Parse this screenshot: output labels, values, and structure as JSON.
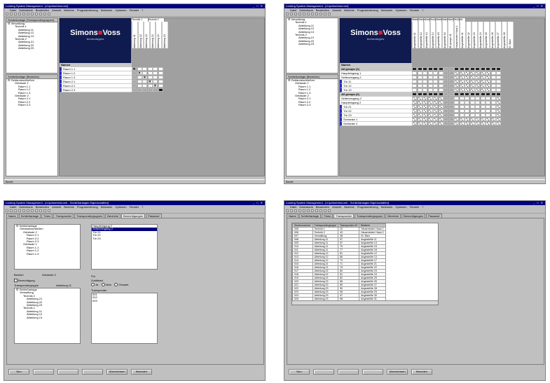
{
  "app": {
    "title": "Locking System Management - [d:\\pc\\lsm\\test.xml]",
    "title_props": "Locking System Management - [d:\\pc\\lsm\\test.xml - Schließanlagen Eigenschaften]",
    "menu": [
      "Datei",
      "Datenbank",
      "Bearbeiten",
      "Ansicht",
      "Berichte",
      "Programmierung",
      "Netzwerk",
      "Optionen",
      "Fenster",
      "?"
    ],
    "status": "Bereit"
  },
  "win1": {
    "tree_top_header": "Schließanlage (Transpondergruppen)",
    "tree_top": [
      "Verwaltung",
      "Technik 1",
      "Abteilung 11",
      "Abteilung 12",
      "Abteilung 13",
      "Technik 2",
      "Abteilung 21",
      "Abteilung 22",
      "Abteilung 23"
    ],
    "tree_bottom_header": "Schließanlage (Bereiche)",
    "tree_bottom": [
      "Gebäudeschließen",
      "Gebäude 1",
      "Raum 1.1",
      "Raum 1.2",
      "Raum 1.3",
      "Gebäude 2",
      "Raum 2.1",
      "Raum 2.2",
      "Raum 2.3"
    ],
    "logo_brand_a": "Simons",
    "logo_brand_b": "Voss",
    "logo_sub": "technologies",
    "col_groups": [
      "Technik 1",
      "Technik 2"
    ],
    "cols": [
      "Abteilung 11",
      "Abteilung 12",
      "Abteilung 13",
      "Abteilung 21",
      "Abteilung 22",
      "Abteilung 23"
    ],
    "rows": [
      "Namen",
      "Raum 1.1",
      "Raum 1.2",
      "Raum 1.3",
      "Raum 2.1",
      "Raum 2.2",
      "Raum 2.3"
    ]
  },
  "win2": {
    "tree_top": [
      "Verwaltung",
      "Technik 1",
      "Abteilung 11",
      "Abteilung 12",
      "Abteilung 13",
      "Technik 2",
      "Abteilung 21",
      "Abteilung 22",
      "Abteilung 23"
    ],
    "tree_bottom_header": "Schließanlage (Bereiche)",
    "tree_bottom": [
      "Gebäudeschließen",
      "Gebäude 1",
      "Raum 1.1",
      "Raum 1.2",
      "Raum 1.3",
      "Gebäude 2",
      "Raum 2.1",
      "Raum 2.2",
      "Raum 2.3"
    ],
    "col_groups": [
      "Abteilung",
      "Abteilung",
      "Abteilung",
      "Technik",
      "Abteilung",
      "Abteilung",
      "Abteilung",
      "Technik",
      "Ab"
    ],
    "cols": [
      "Angestellte 11",
      "Angestellte 12",
      "Angestellte 13",
      "Angestellte 14",
      "Angestellte 15",
      "Angestellte 16",
      "All groups 11",
      "Hausmeister Haus 1",
      "Angestellte 21",
      "Angestellte 22",
      "Angestellte 23",
      "Angestellte 24",
      "Angestellte 25",
      "Angestellte 26",
      "Angestellte 27",
      "Angestellte 28",
      "Dr. Barz"
    ],
    "rows": [
      "Namen",
      "All groups (1)",
      "Haupteingang 1",
      "Seiteneingang 1",
      "Tür 11",
      "Tür 12",
      "Tür 13",
      "All groups (2)",
      "Seiteneingang 2",
      "Haupteingang 2",
      "Tür 21",
      "Tür 22",
      "Tür 23",
      "Schranke 1",
      "Schranke 2"
    ]
  },
  "props": {
    "tabs": [
      "Name",
      "Schließanlage",
      "Türen",
      "Transponder",
      "Transpondergruppen",
      "Bereiche",
      "Berechtigungen",
      "Passwort"
    ],
    "active_tab_3": "Berechtigungen",
    "active_tab_4": "Transponder",
    "buttons": [
      "Neu",
      "Löschen",
      "Ändern",
      "Übernehmen",
      "OK",
      "Abbrechen"
    ],
    "button_labels_shown": [
      "Neu",
      "",
      "",
      "",
      "Übernehmen",
      "Beenden"
    ]
  },
  "win3": {
    "tree_areas": [
      "Schließanlage",
      "Gebäudeschließen",
      "Gebäude 2",
      "Raum 2.1",
      "Raum 2.2",
      "Raum 2.3",
      "Gebäude 1",
      "Raum 1.1",
      "Raum 1.2",
      "Raum 1.3"
    ],
    "doors_list": [
      "Haupteingang 2",
      "Seiteneingang 2",
      "Tür 21",
      "Tür 22",
      "Tür 23"
    ],
    "selected_door": "Seiteneingang 2",
    "bereich_label": "Bereich",
    "bereich_value": "Gebäude 2",
    "checkbox_label": "Berechtigung",
    "tg_label": "Transpondergruppe",
    "tg_value": "Abteilung 11",
    "tree_groups": [
      "Schließanlage",
      "Verwaltung",
      "Technik 2",
      "Abteilung 21",
      "Abteilung 22",
      "Abteilung 23",
      "Technik 1",
      "Abteilung 11",
      "Abteilung 12",
      "Abteilung 13"
    ],
    "fur_label": "Für",
    "zutritt_label": "Zutrittsart",
    "radio_labels": [
      "Ja",
      "Nein",
      "Gesamt"
    ],
    "transponder_label": "Transponder",
    "transponder_list": [
      "001",
      "002",
      "003"
    ]
  },
  "win4": {
    "headers": [
      "Seriennummer",
      "Transpondergruppe",
      "Transponder-ID",
      "Besitzer"
    ],
    "rows": [
      [
        "005",
        "Technik 1",
        "22",
        "Hausmeister Haus 1"
      ],
      [
        "006",
        "Technik 2",
        "43",
        "Hausmeister Haus 2"
      ],
      [
        "007",
        "Verwaltung",
        "48",
        "Dr. Barz"
      ],
      [
        "008",
        "Abteilung 11",
        "57",
        "Angestellte 11"
      ],
      [
        "009",
        "Abteilung 11",
        "57",
        "Angestellte 14"
      ],
      [
        "010",
        "Abteilung 11",
        "70",
        "Angestellte 15"
      ],
      [
        "011",
        "Abteilung 11",
        "77",
        "Angestellte 16"
      ],
      [
        "012",
        "Abteilung 12",
        "81",
        "Angestellte 12"
      ],
      [
        "013",
        "Abteilung 12",
        "86",
        "Angestellte 13"
      ],
      [
        "014",
        "Abteilung 12",
        "72",
        "Angestellte 17"
      ],
      [
        "015",
        "Abteilung 21",
        "71",
        "Angestellte 21"
      ],
      [
        "016",
        "Abteilung 21",
        "79",
        "Angestellte 22"
      ],
      [
        "017",
        "Abteilung 22",
        "80",
        "Angestellte 23"
      ],
      [
        "018",
        "Abteilung 22",
        "81",
        "Angestellte 24"
      ],
      [
        "019",
        "Abteilung 22",
        "82",
        "Angestellte 25"
      ],
      [
        "020",
        "Abteilung 23",
        "88",
        "Angestellte 26"
      ],
      [
        "021",
        "Abteilung 23",
        "89",
        "Angestellte 27"
      ],
      [
        "022",
        "Abteilung 23",
        "90",
        "Angestellte 28"
      ],
      [
        "023",
        "Abteilung 23",
        "96",
        "Angestellte 29"
      ],
      [
        "024",
        "Abteilung 23",
        "97",
        "Angestellte 30"
      ],
      [
        "025",
        "Abteilung 23",
        "98",
        "Angestellte 31"
      ]
    ]
  }
}
